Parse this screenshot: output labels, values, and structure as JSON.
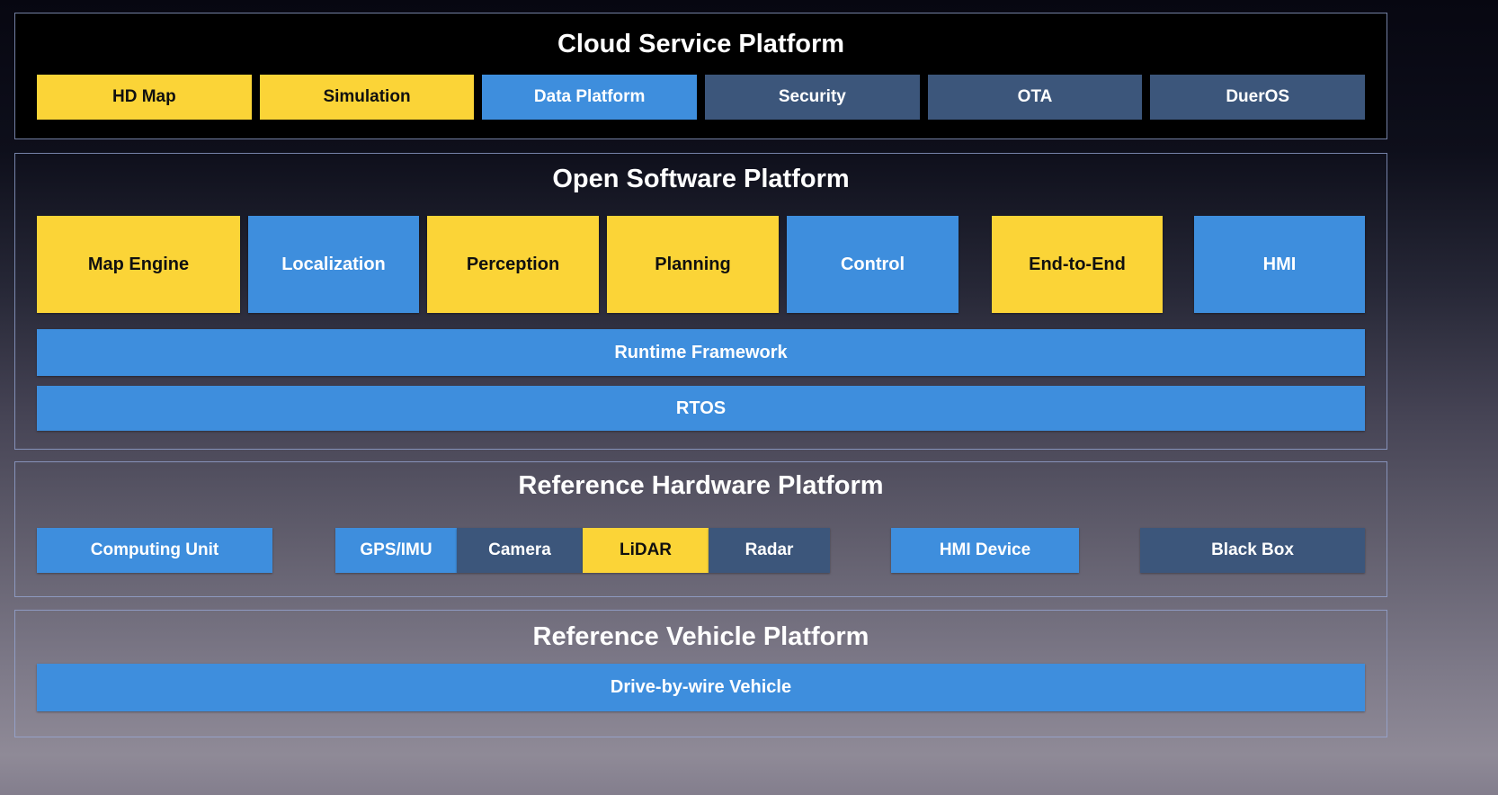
{
  "palette": {
    "yellow": "#FBD437",
    "blue": "#3E8EDD",
    "navy": "#3C567B",
    "section_border": "#98AAD8",
    "cloud_background": "#000000",
    "title_text": "#FFFFFF"
  },
  "sections": {
    "cloud": {
      "title": "Cloud Service Platform",
      "items": [
        {
          "label": "HD Map",
          "variant": "yellow"
        },
        {
          "label": "Simulation",
          "variant": "yellow"
        },
        {
          "label": "Data Platform",
          "variant": "blue"
        },
        {
          "label": "Security",
          "variant": "navy"
        },
        {
          "label": "OTA",
          "variant": "navy"
        },
        {
          "label": "DuerOS",
          "variant": "navy"
        }
      ]
    },
    "software": {
      "title": "Open Software Platform",
      "modules": [
        {
          "label": "Map Engine",
          "variant": "yellow"
        },
        {
          "label": "Localization",
          "variant": "blue"
        },
        {
          "label": "Perception",
          "variant": "yellow"
        },
        {
          "label": "Planning",
          "variant": "yellow"
        },
        {
          "label": "Control",
          "variant": "blue"
        },
        {
          "label": "End-to-End",
          "variant": "yellow"
        },
        {
          "label": "HMI",
          "variant": "blue"
        }
      ],
      "bars": [
        {
          "label": "Runtime Framework",
          "variant": "blue"
        },
        {
          "label": "RTOS",
          "variant": "blue"
        }
      ]
    },
    "hardware": {
      "title": "Reference Hardware Platform",
      "items": [
        {
          "label": "Computing Unit",
          "variant": "blue"
        },
        {
          "label": "GPS/IMU",
          "variant": "blue"
        },
        {
          "label": "Camera",
          "variant": "navy"
        },
        {
          "label": "LiDAR",
          "variant": "yellow"
        },
        {
          "label": "Radar",
          "variant": "navy"
        },
        {
          "label": "HMI Device",
          "variant": "blue"
        },
        {
          "label": "Black Box",
          "variant": "navy"
        }
      ]
    },
    "vehicle": {
      "title": "Reference Vehicle Platform",
      "bar": {
        "label": "Drive-by-wire Vehicle",
        "variant": "blue"
      }
    }
  }
}
